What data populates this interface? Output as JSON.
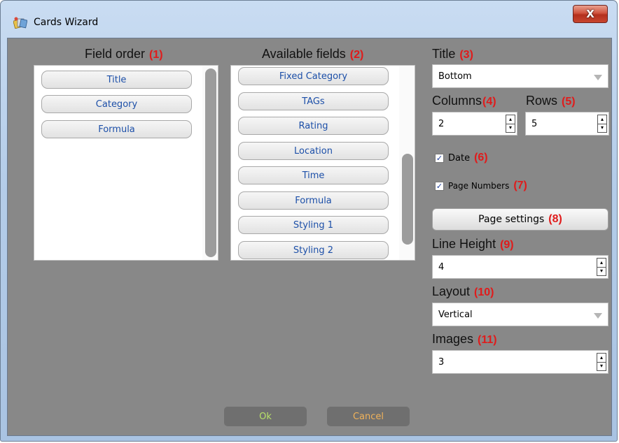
{
  "window": {
    "title": "Cards Wizard",
    "close_label": "X"
  },
  "field_order": {
    "label": "Field order",
    "num": "(1)",
    "items": [
      "Title",
      "Category",
      "Formula"
    ]
  },
  "available_fields": {
    "label": "Available fields",
    "num": "(2)",
    "items": [
      "Fixed Category",
      "TAGs",
      "Rating",
      "Location",
      "Time",
      "Formula",
      "Styling 1",
      "Styling 2"
    ]
  },
  "title_opt": {
    "label": "Title",
    "num": "(3)",
    "value": "Bottom"
  },
  "columns": {
    "label": "Columns",
    "num": "(4)",
    "value": "2"
  },
  "rows": {
    "label": "Rows",
    "num": "(5)",
    "value": "5"
  },
  "date": {
    "label": "Date",
    "num": "(6)",
    "checked": true
  },
  "page_numbers": {
    "label": "Page Numbers",
    "num": "(7)",
    "checked": true
  },
  "page_settings": {
    "label": "Page settings",
    "num": "(8)"
  },
  "line_height": {
    "label": "Line Height",
    "num": "(9)",
    "value": "4"
  },
  "layout": {
    "label": "Layout",
    "num": "(10)",
    "value": "Vertical"
  },
  "images": {
    "label": "Images",
    "num": "(11)",
    "value": "3"
  },
  "footer": {
    "ok_label": "Ok",
    "cancel_label": "Cancel"
  },
  "colors": {
    "client_bg": "#888888",
    "chip_text": "#1c4fa8",
    "number_red": "#e01b1b",
    "ok_text": "#b7e06a",
    "cancel_text": "#f0b25a"
  },
  "icons": {
    "app": "cards-app-icon",
    "close": "close-icon",
    "check": "checkmark-icon",
    "dropdown": "dropdown-arrow-icon",
    "spin": "spin-arrows-icon"
  }
}
